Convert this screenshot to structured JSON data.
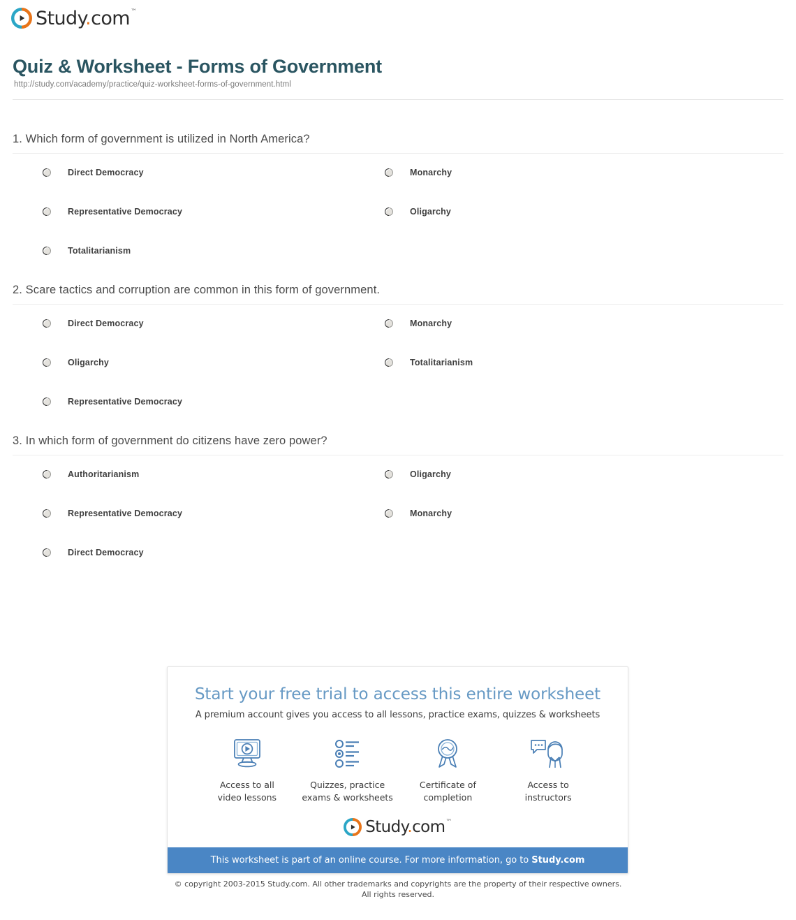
{
  "brand": {
    "name": "Study",
    "dot": ".",
    "suffix": "com",
    "trademark": "™",
    "mark_icon": "play-circle-icon",
    "colors": {
      "teal": "#2ba6c6",
      "orange": "#e8751a",
      "wordmark": "#2c2c2c"
    }
  },
  "header": {
    "title": "Quiz & Worksheet - Forms of Government",
    "url": "http://study.com/academy/practice/quiz-worksheet-forms-of-government.html",
    "title_color": "#2a5561"
  },
  "questions": [
    {
      "text": "1. Which form of government is utilized in North America?",
      "options": [
        {
          "label": "Direct Democracy",
          "column": "left",
          "row": 0
        },
        {
          "label": "Monarchy",
          "column": "right",
          "row": 0
        },
        {
          "label": "Representative Democracy",
          "column": "left",
          "row": 1
        },
        {
          "label": "Oligarchy",
          "column": "right",
          "row": 1
        },
        {
          "label": "Totalitarianism",
          "column": "left",
          "row": 2
        }
      ]
    },
    {
      "text": "2. Scare tactics and corruption are common in this form of government.",
      "options": [
        {
          "label": "Direct Democracy",
          "column": "left",
          "row": 0
        },
        {
          "label": "Monarchy",
          "column": "right",
          "row": 0
        },
        {
          "label": "Oligarchy",
          "column": "left",
          "row": 1
        },
        {
          "label": "Totalitarianism",
          "column": "right",
          "row": 1
        },
        {
          "label": "Representative Democracy",
          "column": "left",
          "row": 2
        }
      ]
    },
    {
      "text": "3. In which form of government do citizens have zero power?",
      "options": [
        {
          "label": "Authoritarianism",
          "column": "left",
          "row": 0
        },
        {
          "label": "Oligarchy",
          "column": "right",
          "row": 0
        },
        {
          "label": "Representative Democracy",
          "column": "left",
          "row": 1
        },
        {
          "label": "Monarchy",
          "column": "right",
          "row": 1
        },
        {
          "label": "Direct Democracy",
          "column": "left",
          "row": 2
        }
      ]
    }
  ],
  "promo": {
    "headline": "Start your free trial to access this entire worksheet",
    "subheadline": "A premium account gives you access to all lessons, practice exams, quizzes & worksheets",
    "headline_color": "#6699c4",
    "benefits": [
      {
        "icon": "monitor-play-icon",
        "line1": "Access to all",
        "line2": "video lessons"
      },
      {
        "icon": "quiz-list-icon",
        "line1": "Quizzes, practice",
        "line2": "exams & worksheets"
      },
      {
        "icon": "award-ribbon-icon",
        "line1": "Certificate of",
        "line2": "completion"
      },
      {
        "icon": "instructor-chat-icon",
        "line1": "Access to",
        "line2": "instructors"
      }
    ],
    "footer_text": "This worksheet is part of an online course. For more information, go to ",
    "footer_link": "Study.com",
    "footer_bg": "#4a86c5"
  },
  "copyright": {
    "line1": "© copyright 2003-2015 Study.com. All other trademarks and copyrights are the property of their respective owners.",
    "line2": "All rights reserved."
  }
}
